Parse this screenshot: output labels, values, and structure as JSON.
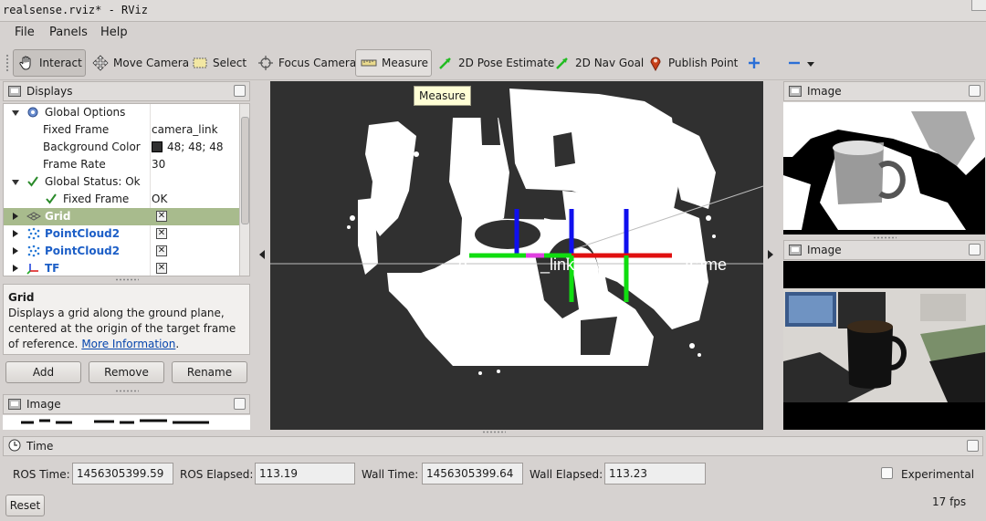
{
  "window": {
    "title": "realsense.rviz* - RViz"
  },
  "menu": [
    "File",
    "Panels",
    "Help"
  ],
  "toolbar": {
    "interact": "Interact",
    "move_camera": "Move Camera",
    "select": "Select",
    "focus_camera": "Focus Camera",
    "measure": "Measure",
    "pose_estimate": "2D Pose Estimate",
    "nav_goal": "2D Nav Goal",
    "publish_point": "Publish Point"
  },
  "tooltip": "Measure",
  "displays_panel": {
    "title": "Displays",
    "rows": [
      {
        "label": "Global Options"
      },
      {
        "label": "Fixed Frame",
        "value": "camera_link"
      },
      {
        "label": "Background Color",
        "value": "48; 48; 48"
      },
      {
        "label": "Frame Rate",
        "value": "30"
      },
      {
        "label": "Global Status: Ok"
      },
      {
        "label": "Fixed Frame",
        "value": "OK"
      },
      {
        "label": "Grid"
      },
      {
        "label": "PointCloud2"
      },
      {
        "label": "PointCloud2"
      },
      {
        "label": "TF"
      }
    ],
    "description_title": "Grid",
    "description_text": "Displays a grid along the ground plane, centered at the origin of the target frame of reference.",
    "description_link": "More Information",
    "description_end": ".",
    "buttons": {
      "add": "Add",
      "remove": "Remove",
      "rename": "Rename"
    }
  },
  "image_panel_left": {
    "title": "Image"
  },
  "viewport": {
    "frame_text": "camera_link"
  },
  "image_panels_right": [
    {
      "title": "Image"
    },
    {
      "title": "Image"
    }
  ],
  "time_panel": {
    "title": "Time",
    "ros_time_label": "ROS Time:",
    "ros_time": "1456305399.59",
    "ros_elapsed_label": "ROS Elapsed:",
    "ros_elapsed": "113.19",
    "wall_time_label": "Wall Time:",
    "wall_time": "1456305399.64",
    "wall_elapsed_label": "Wall Elapsed:",
    "wall_elapsed": "113.23",
    "experimental_label": "Experimental",
    "reset": "Reset",
    "fps": "17 fps"
  },
  "colors": {
    "background": "#303030",
    "selected_row": "#a8bb8d",
    "link": "#0645ad",
    "tf_red": "#e01010",
    "tf_green": "#10dd10",
    "tf_blue": "#1010ee"
  }
}
